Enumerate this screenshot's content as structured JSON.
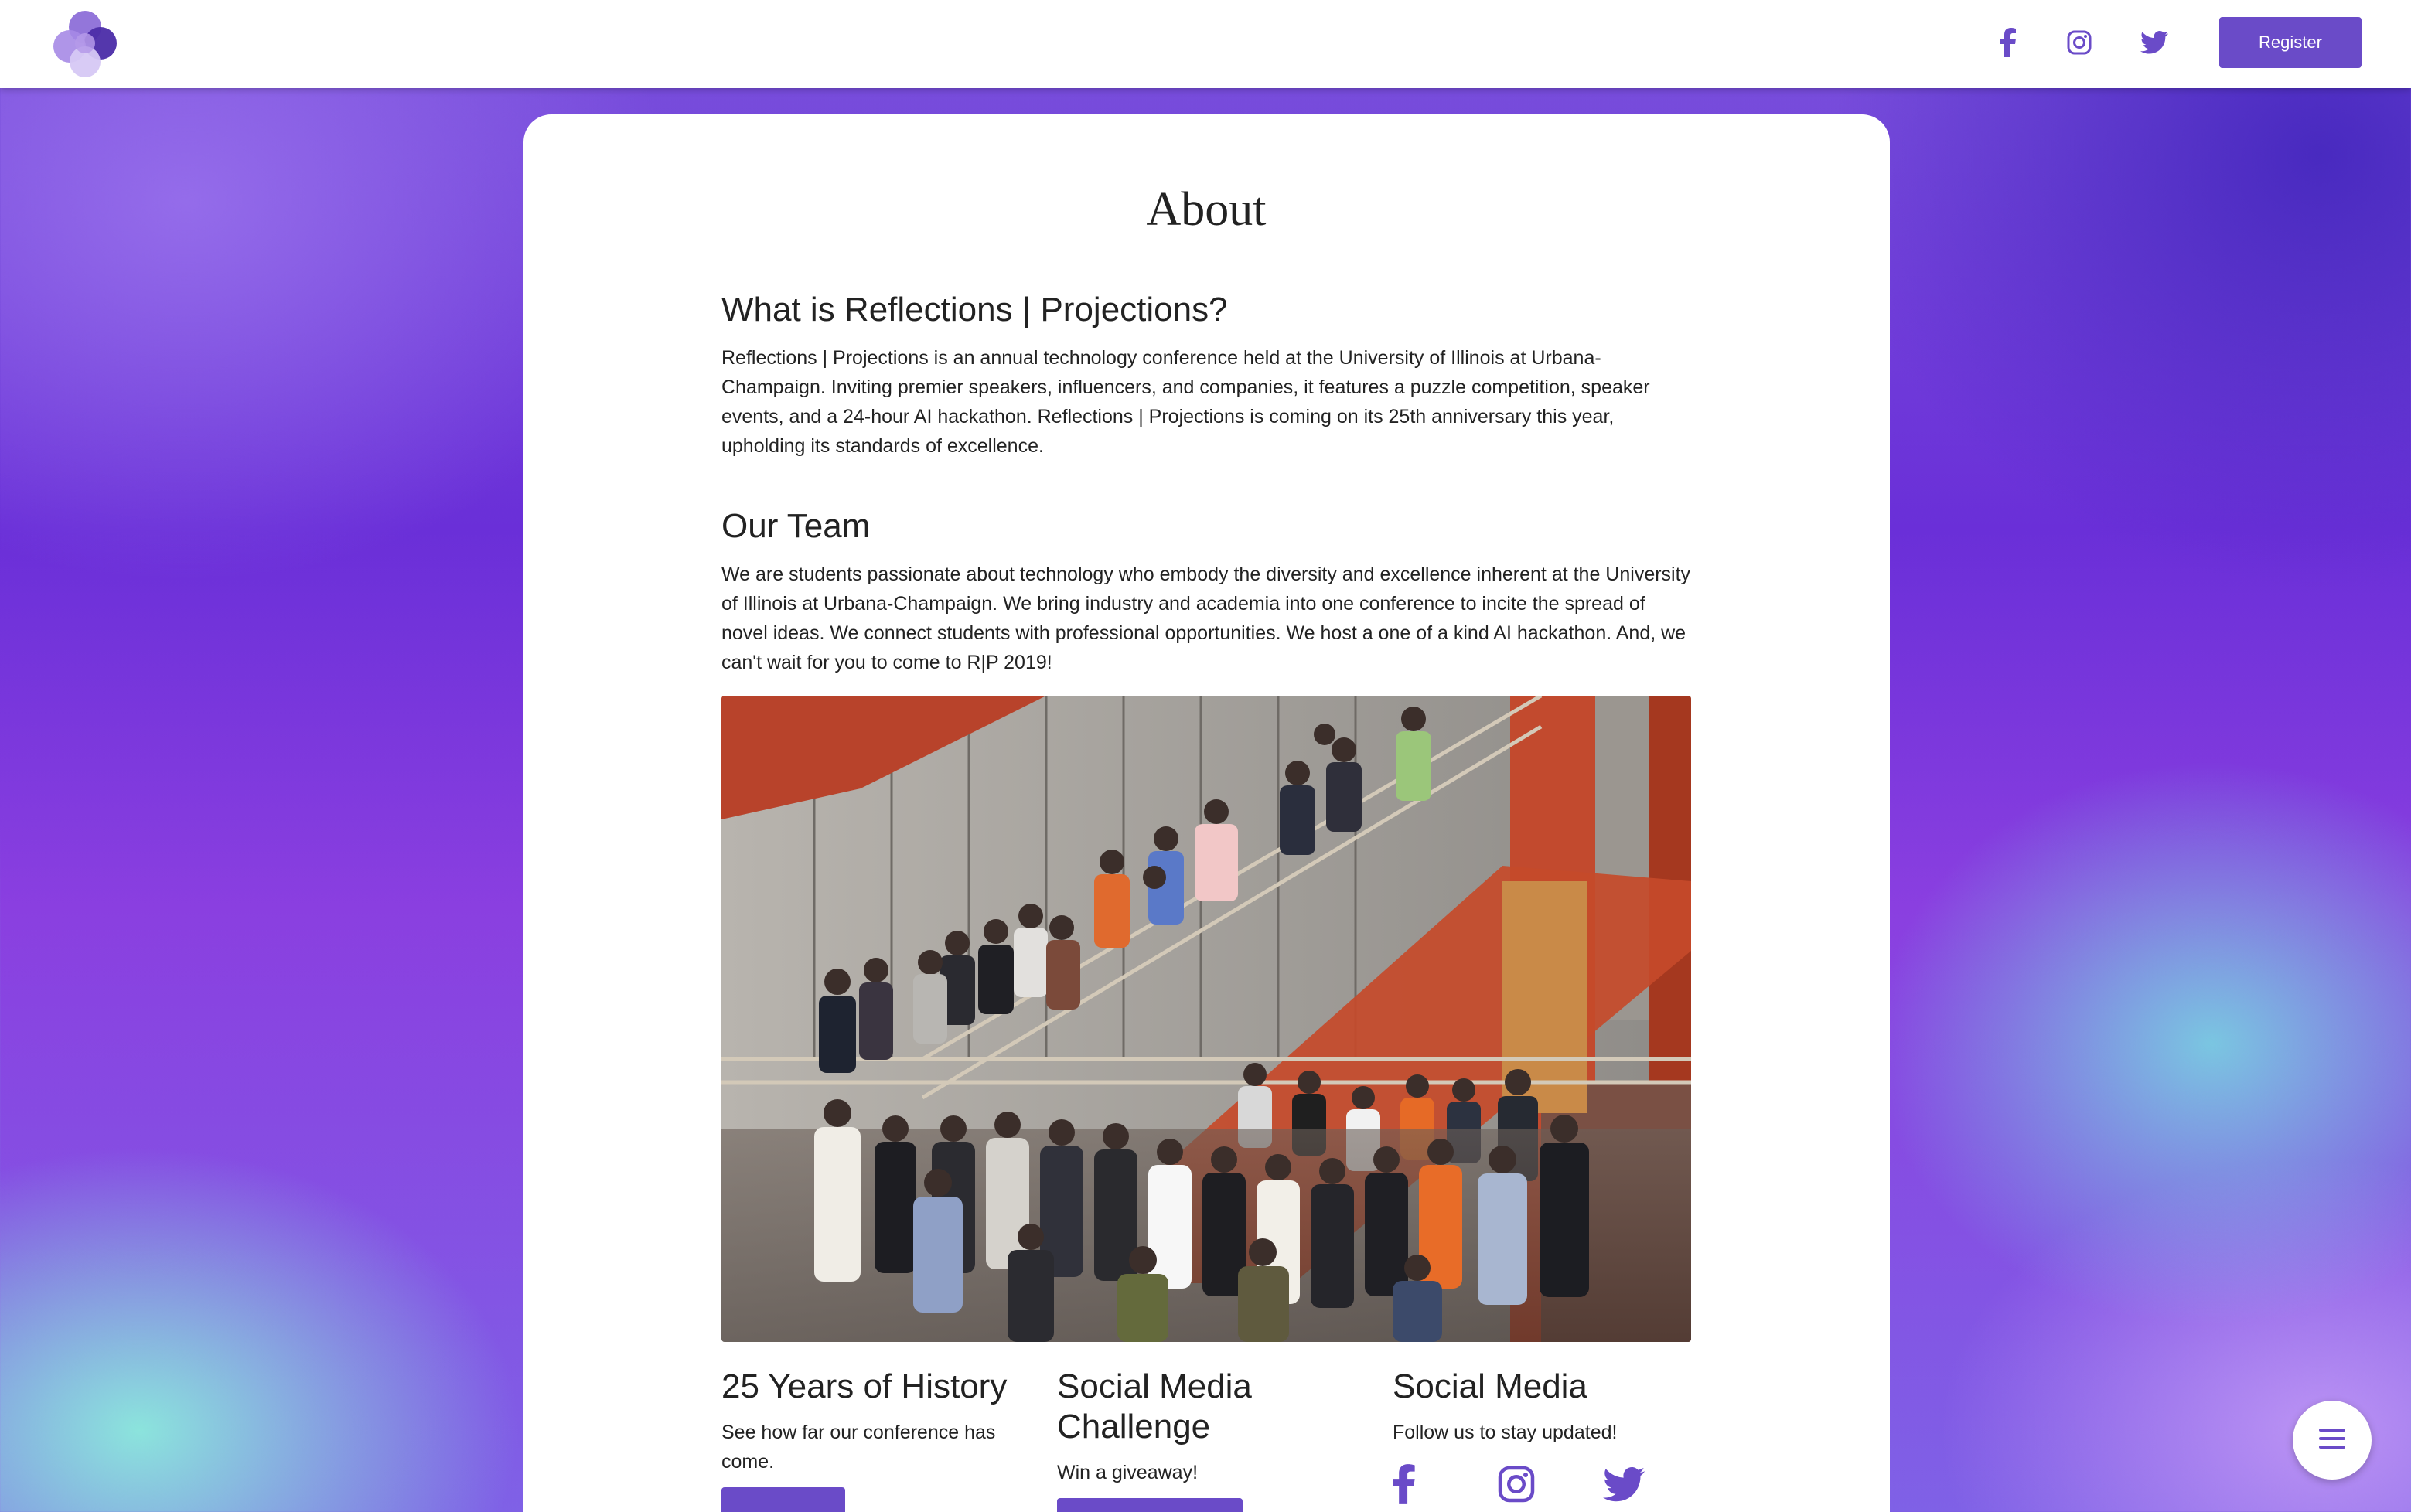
{
  "header": {
    "logo_name": "rp-logo",
    "social_icons": [
      "facebook-icon",
      "instagram-icon",
      "twitter-icon"
    ],
    "register_label": "Register"
  },
  "about": {
    "title": "About",
    "what_heading": "What is Reflections | Projections?",
    "what_text": "Reflections | Projections is an annual technology conference held at the University of Illinois at Urbana-Champaign. Inviting premier speakers, influencers, and companies, it features a puzzle competition, speaker events, and a 24-hour AI hackathon. Reflections | Projections is coming on its 25th anniversary this year, upholding its standards of excellence.",
    "team_heading": "Our Team",
    "team_text": "We are students passionate about technology who embody the diversity and excellence inherent at the University of Illinois at Urbana-Champaign. We bring industry and academia into one conference to incite the spread of novel ideas. We connect students with professional opportunities. We host a one of a kind AI hackathon. And, we can't wait for you to come to R|P 2019!"
  },
  "features": {
    "history": {
      "heading": "25 Years of History",
      "text": "See how far our conference has come."
    },
    "challenge": {
      "heading": "Social Media Challenge",
      "text": "Win a giveaway!"
    },
    "social": {
      "heading": "Social Media",
      "text": "Follow us to stay updated!"
    }
  },
  "colors": {
    "accent": "#6a4bc8",
    "text": "#222222",
    "card": "#ffffff"
  },
  "fab": {
    "icon": "menu-icon"
  }
}
